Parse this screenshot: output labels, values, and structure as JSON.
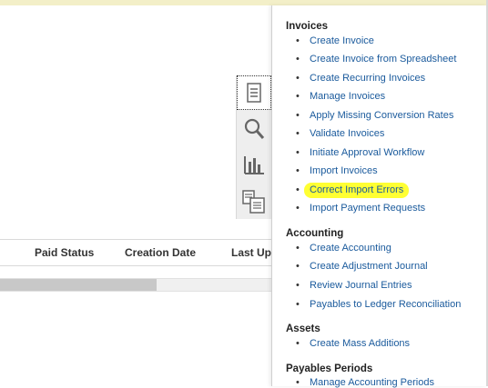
{
  "table": {
    "columns": [
      "Paid Status",
      "Creation Date",
      "Last Up"
    ]
  },
  "toolbar": {
    "icons": [
      "tasks-icon",
      "search-icon",
      "reports-icon",
      "documents-icon"
    ]
  },
  "panel": {
    "sections": [
      {
        "title": "Invoices",
        "items": [
          "Create Invoice",
          "Create Invoice from Spreadsheet",
          "Create Recurring Invoices",
          "Manage Invoices",
          "Apply Missing Conversion Rates",
          "Validate Invoices",
          "Initiate Approval Workflow",
          "Import Invoices",
          "Correct Import Errors",
          "Import Payment Requests"
        ]
      },
      {
        "title": "Accounting",
        "items": [
          "Create Accounting",
          "Create Adjustment Journal",
          "Review Journal Entries",
          "Payables to Ledger Reconciliation"
        ]
      },
      {
        "title": "Assets",
        "items": [
          "Create Mass Additions"
        ]
      },
      {
        "title": "Payables Periods",
        "items": [
          "Manage Accounting Periods"
        ]
      }
    ],
    "highlighted_item": "Correct Import Errors",
    "highlight_color": "#ffff33",
    "link_color": "#1a5a9c"
  }
}
